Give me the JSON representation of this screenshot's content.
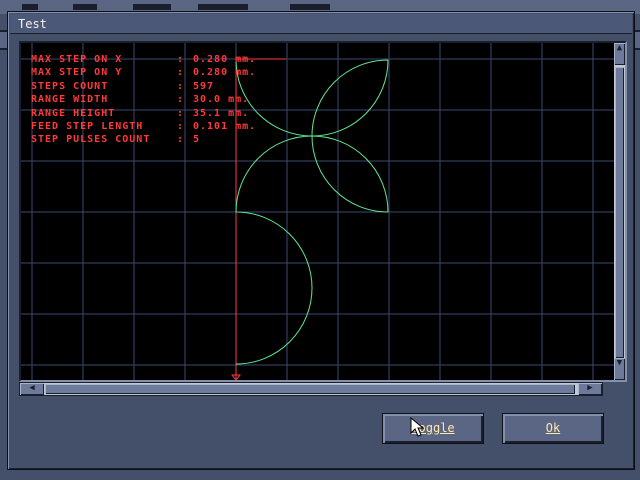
{
  "window": {
    "title": "Test"
  },
  "info": [
    {
      "label": "MAX STEP ON X",
      "value": "0.280 mm."
    },
    {
      "label": "MAX STEP ON Y",
      "value": "0.280 mm."
    },
    {
      "label": "STEPS COUNT",
      "value": "597"
    },
    {
      "label": "RANGE WIDTH",
      "value": "30.0 mm."
    },
    {
      "label": "RANGE HEIGHT",
      "value": "35.1 mm."
    },
    {
      "label": "FEED STEP LENGTH",
      "value": "0.101 mm."
    },
    {
      "label": "STEP PULSES COUNT",
      "value": "5"
    }
  ],
  "separator": ":",
  "buttons": {
    "toggle": "Toggle",
    "ok": "Ok"
  },
  "colors": {
    "grid": "#3e4a72",
    "path": "#60e890",
    "axis": "#ff3a3a",
    "info_text": "#ff3a3a",
    "button_text": "#ffe8a8"
  }
}
